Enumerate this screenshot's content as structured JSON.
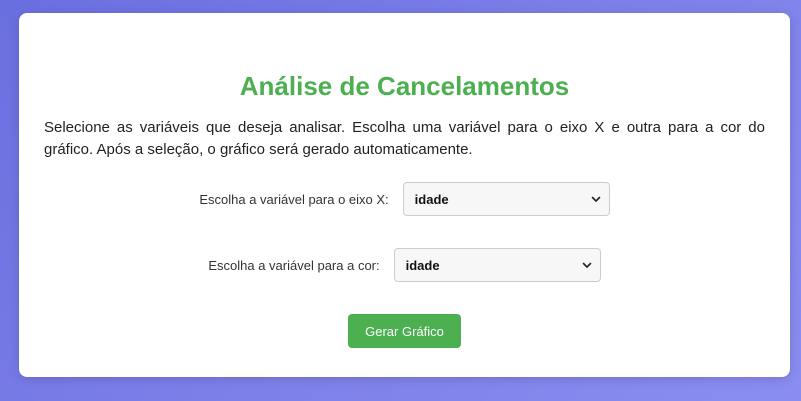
{
  "page": {
    "title": "Análise de Cancelamentos",
    "description": "Selecione as variáveis que deseja analisar. Escolha uma variável para o eixo X e outra para a cor do gráfico. Após a seleção, o gráfico será gerado automaticamente."
  },
  "form": {
    "x_axis": {
      "label": "Escolha a variável para o eixo X:",
      "selected": "idade"
    },
    "color": {
      "label": "Escolha a variável para a cor:",
      "selected": "idade"
    },
    "submit_label": "Gerar Gráfico"
  },
  "colors": {
    "accent": "#4caf50",
    "background_start": "#6a6fe0",
    "background_end": "#8a8df0"
  },
  "icons": {
    "select_arrow": "chevron-down-icon"
  }
}
